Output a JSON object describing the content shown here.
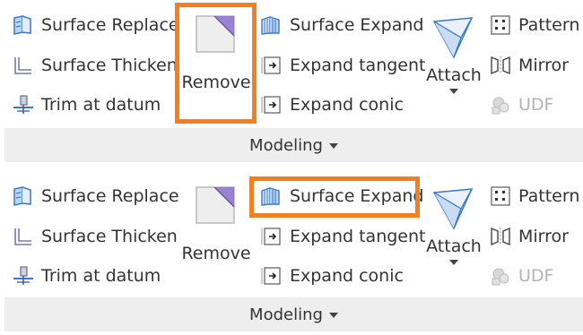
{
  "top": {
    "col1": [
      "Surface Replace",
      "Surface Thicken",
      "Trim at datum"
    ],
    "remove": "Remove",
    "col3": [
      "Surface Expand",
      "Expand tangent",
      "Expand conic"
    ],
    "attach": "Attach",
    "col5": [
      "Pattern",
      "Mirror",
      "UDF"
    ],
    "group_label": "Modeling",
    "highlighted": "Remove"
  },
  "bottom": {
    "col1": [
      "Surface Replace",
      "Surface Thicken",
      "Trim at datum"
    ],
    "remove": "Remove",
    "col3": [
      "Surface Expand",
      "Expand tangent",
      "Expand conic"
    ],
    "attach": "Attach",
    "col5": [
      "Pattern",
      "Mirror",
      "UDF"
    ],
    "group_label": "Modeling",
    "highlighted": "Surface Expand"
  },
  "colors": {
    "highlight": "#f57e20",
    "icon_blue": "#3a79c9",
    "icon_purple": "#8a6fc9",
    "group_bar": "#eeeeee",
    "disabled_text": "#b4b4b4"
  },
  "icons": {
    "surface_replace": "surface-replace-icon",
    "surface_thicken": "surface-thicken-icon",
    "trim_at_datum": "trim-at-datum-icon",
    "remove": "remove-icon",
    "surface_expand": "surface-expand-icon",
    "expand_tangent": "expand-tangent-icon",
    "expand_conic": "expand-conic-icon",
    "attach": "attach-icon",
    "pattern": "pattern-icon",
    "mirror": "mirror-icon",
    "udf": "udf-icon"
  }
}
